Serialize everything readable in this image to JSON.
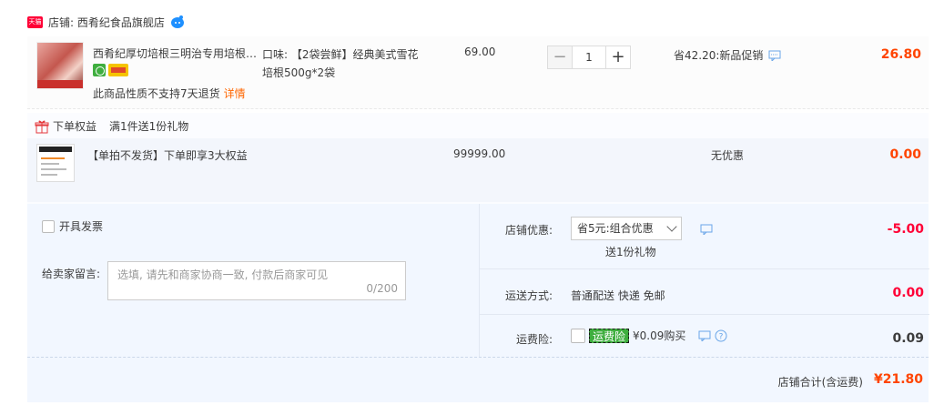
{
  "shop": {
    "badge": "天猫",
    "label": "店铺: 西肴纪食品旗舰店"
  },
  "item": {
    "title": "西肴纪厚切培根三明治专用培根…",
    "no_return_text": "此商品性质不支持7天退货",
    "detail_link": "详情",
    "spec": "口味: 【2袋尝鲜】经典美式雪花培根500g*2袋",
    "price": "69.00",
    "quantity": "1",
    "promo": "省42.20:新品促销",
    "subtotal": "26.80"
  },
  "gift_section": {
    "title": "下单权益",
    "rule": "满1件送1份礼物",
    "item_name": "【单拍不发货】下单即享3大权益",
    "item_price": "99999.00",
    "discount": "无优惠",
    "subtotal": "0.00"
  },
  "order_options": {
    "invoice_label": "开具发票",
    "message_label": "给卖家留言:",
    "message_placeholder": "选填, 请先和商家协商一致, 付款后商家可见",
    "message_count": "0/200"
  },
  "summary": {
    "coupon_label": "店铺优惠:",
    "coupon_selected": "省5元:组合优惠",
    "coupon_gift_note": "送1份礼物",
    "coupon_value": "-5.00",
    "shipping_label": "运送方式:",
    "shipping_method": "普通配送 快递 免邮",
    "shipping_value": "0.00",
    "insurance_label": "运费险:",
    "insurance_tag": "运费险",
    "insurance_price": "¥0.09购买",
    "insurance_value": "0.09",
    "total_label": "店铺合计(含运费)",
    "total_value": "¥21.80"
  },
  "colors": {
    "price_orange": "#ff4400",
    "discount_red": "#ff0036",
    "panel_blue": "#f2f7ff"
  }
}
